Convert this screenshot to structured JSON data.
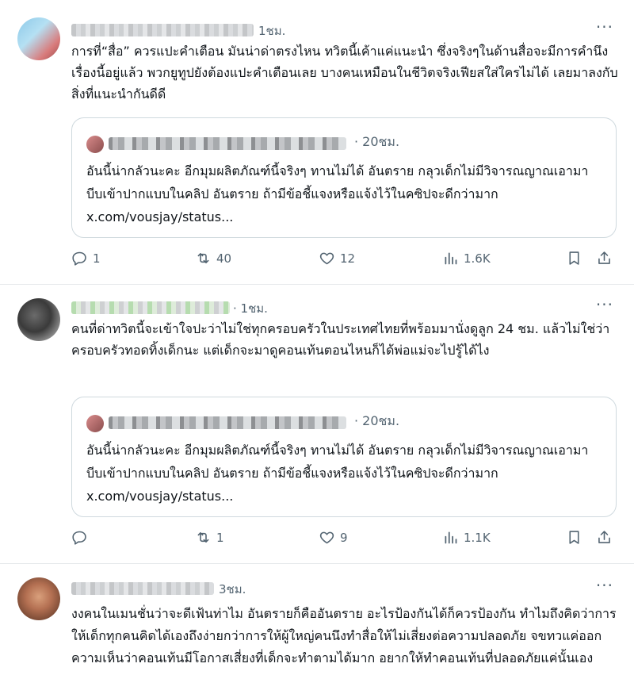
{
  "tweets": [
    {
      "time": "1ชม.",
      "more": "···",
      "text": "การที่“สื่อ” ควรแปะคำเตือน มันน่าด่าตรงไหน ทวิตนี้เค้าแค่แนะนำ ซึ่งจริงๆในด้านสื่อจะมีการคำนึงเรื่องนี้อยู่แล้ว พวกยูทูปยังต้องแปะคำเตือนเลย บางคนเหมือนในชีวิตจริงเฟียสใส่ใครไม่ได้ เลยมาลงกับสิ่งที่แนะนำกันดีดี",
      "quote": {
        "time": "· 20ชม.",
        "text": "อันนี้น่ากลัวนะคะ อีกมุมผลิตภัณฑ์นี้จริงๆ ทานไม่ได้ อันตราย กลุวเด็กไม่มีวิจารณญาณเอามาบีบเข้าปากแบบในคลิป อันตราย ถ้ามีข้อชี้แจงหรือแจ้งไว้ในคซิปจะดีกว่ามาก x.com/vousjay/status..."
      },
      "replies": "1",
      "reposts": "40",
      "likes": "12",
      "views": "1.6K"
    },
    {
      "time": "· 1ชม.",
      "more": "···",
      "text": "คนที่ด่าทวิตนี้จะเข้าใจปะว่าไม่ใช่ทุกครอบครัวในประเทศไทยที่พร้อมมานั่งดูลูก 24 ชม. แล้วไม่ใช่ว่าครอบครัวทอดทิ้งเด็กนะ แต่เด็กจะมาดูคอนเท้นตอนไหนก็ได้พ่อแม่จะไปรู้ได้ไง",
      "quote": {
        "time": "· 20ชม.",
        "text": "อันนี้น่ากลัวนะคะ อีกมุมผลิตภัณฑ์นี้จริงๆ ทานไม่ได้ อันตราย กลุวเด็กไม่มีวิจารณญาณเอามาบีบเข้าปากแบบในคลิป อันตราย ถ้ามีข้อชี้แจงหรือแจ้งไว้ในคซิปจะดีกว่ามาก x.com/vousjay/status..."
      },
      "replies": "",
      "reposts": "1",
      "likes": "9",
      "views": "1.1K"
    },
    {
      "time": "3ชม.",
      "more": "···",
      "text": "งงคนในเมนชั่นว่าจะดีเฟ้นท่าไม อันตรายก็คืออันตราย อะไรป้องกันได้ก็ควรป้องกัน ทำไมถึงคิดว่าการให้เด็กทุกคนคิดได้เองถึงง่ายกว่าการให้ผู้ใหญ่คนนึงทำสื่อให้ไม่เสี่ยงต่อความปลอดภัย จขทวแค่ออกความเห็นว่าคอนเท้นมีโอกาสเสี่ยงที่เด็กจะทำตามได้มาก อยากให้ทำคอนเท้นที่ปลอดภัยแค่นั้นเอง"
    }
  ]
}
